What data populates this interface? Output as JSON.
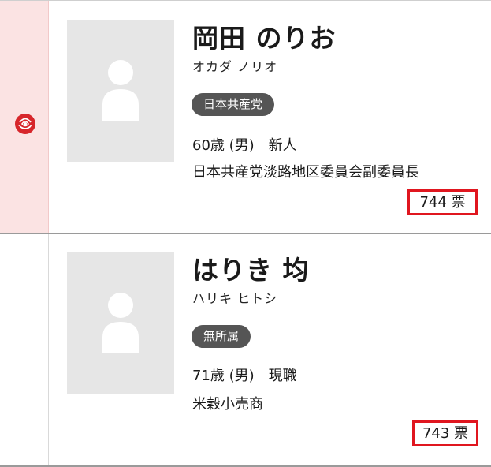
{
  "candidates": [
    {
      "name": "岡田 のりお",
      "kana": "オカダ ノリオ",
      "party": "日本共産党",
      "age_gender": "60歳 (男)",
      "status": "新人",
      "occupation": "日本共産党淡路地区委員会副委員長",
      "votes": "744 票",
      "elected": true,
      "photo_icon": "person-placeholder-icon",
      "mark_icon": "rose-icon"
    },
    {
      "name": "はりき 均",
      "kana": "ハリキ ヒトシ",
      "party": "無所属",
      "age_gender": "71歳 (男)",
      "status": "現職",
      "occupation": "米穀小売商",
      "votes": "743 票",
      "elected": false,
      "photo_icon": "person-placeholder-icon"
    }
  ],
  "colors": {
    "elected_column": "#fbe3e3",
    "rose": "#d7262b",
    "party_badge": "#555555",
    "vote_border": "#e0161f",
    "photo_bg": "#e6e6e6"
  }
}
